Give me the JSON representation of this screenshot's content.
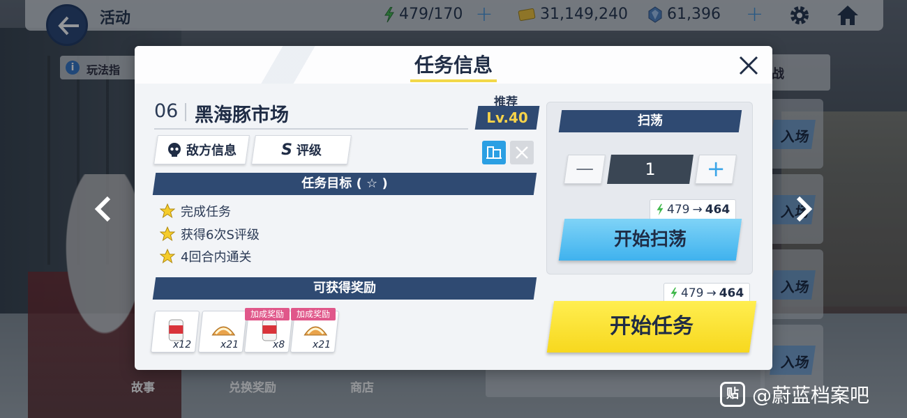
{
  "topbar": {
    "title": "活动",
    "ap": "479/170",
    "credits": "31,149,240",
    "gems": "61,396",
    "icons": [
      "back-arrow-icon",
      "bolt-icon",
      "ticket-icon",
      "gem-icon",
      "gear-icon",
      "home-icon"
    ]
  },
  "background": {
    "howto_label": "玩法指",
    "side_head_label": "战",
    "side_card_labels": [
      "入场",
      "入场",
      "入场",
      "入场"
    ],
    "bottom_tabs": [
      "故事",
      "兑换奖励",
      "商店"
    ]
  },
  "watermark": {
    "logo": "贴",
    "text": "@蔚蓝档案吧"
  },
  "modal": {
    "title": "任务信息",
    "stage_number": "06",
    "stage_name": "黑海豚市场",
    "recommend_label": "推荐",
    "level": "Lv.40",
    "enemy_info_label": "敌方信息",
    "rank_letter": "S",
    "rank_label": "评级",
    "objectives_header": "任务目标 ( ☆ )",
    "objectives": [
      "完成任务",
      "获得6次S评级",
      "4回合内通关"
    ],
    "rewards_header": "可获得奖励",
    "rewards": [
      {
        "qty": "x12",
        "bonus": ""
      },
      {
        "qty": "x21",
        "bonus": ""
      },
      {
        "qty": "x8",
        "bonus": "加成奖励"
      },
      {
        "qty": "x21",
        "bonus": "加成奖励"
      }
    ],
    "sweep": {
      "header": "扫荡",
      "minus": "—",
      "count": "1",
      "plus": "+",
      "cost_from": "479",
      "cost_arrow": "→",
      "cost_to": "464",
      "button": "开始扫荡"
    },
    "start": {
      "cost_from": "479",
      "cost_arrow": "→",
      "cost_to": "464",
      "button": "开始任务"
    }
  },
  "colors": {
    "navy": "#2f4a72",
    "yellow": "#f7d81e",
    "sky": "#3fb2ee",
    "bolt": "#3fb84a"
  }
}
